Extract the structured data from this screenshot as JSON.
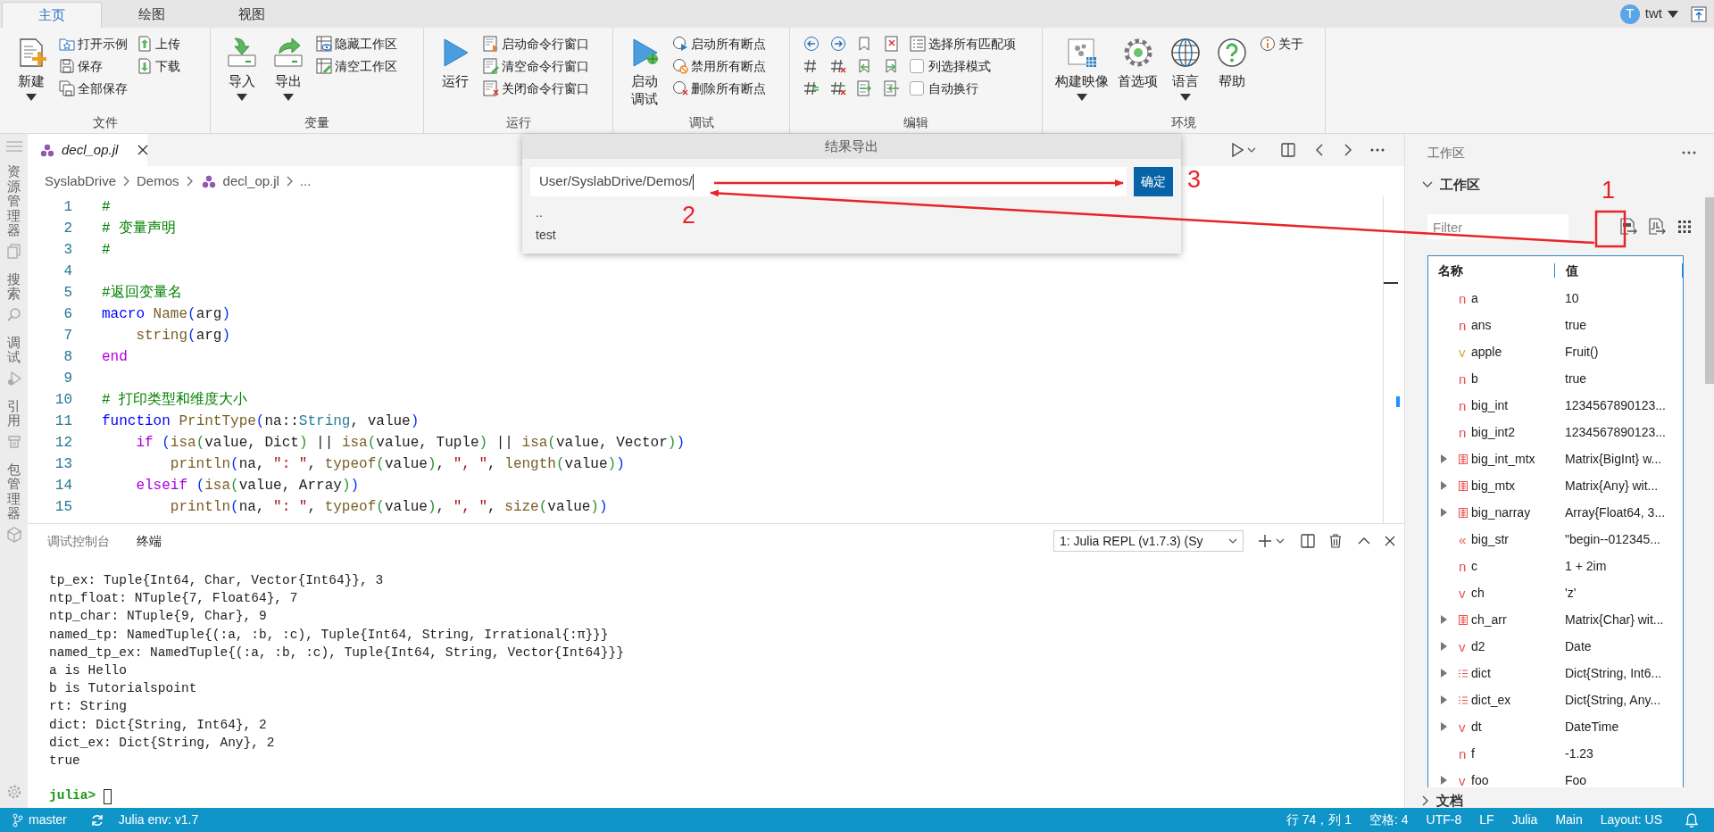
{
  "ribbon": {
    "tabs": [
      {
        "label": "主页",
        "selected": true
      },
      {
        "label": "绘图",
        "selected": false
      },
      {
        "label": "视图",
        "selected": false
      }
    ],
    "user": {
      "initial": "T",
      "name": "twt"
    },
    "groups": [
      {
        "label": "文件",
        "items": [
          {
            "kind": "large",
            "label": "新建",
            "dropdown": true
          },
          {
            "kind": "small",
            "label": "打开示例"
          },
          {
            "kind": "small",
            "label": "保存"
          },
          {
            "kind": "small",
            "label": "全部保存"
          },
          {
            "kind": "small",
            "label": "上传"
          },
          {
            "kind": "small",
            "label": "下载"
          }
        ]
      },
      {
        "label": "变量",
        "items": [
          {
            "kind": "large",
            "label": "导入",
            "dropdown": true
          },
          {
            "kind": "large",
            "label": "导出",
            "dropdown": true
          },
          {
            "kind": "small",
            "label": "隐藏工作区"
          },
          {
            "kind": "small",
            "label": "清空工作区"
          }
        ]
      },
      {
        "label": "运行",
        "items": [
          {
            "kind": "large",
            "label": "运行",
            "dropdown": false
          },
          {
            "kind": "small",
            "label": "启动命令行窗口"
          },
          {
            "kind": "small",
            "label": "清空命令行窗口"
          },
          {
            "kind": "small",
            "label": "关闭命令行窗口"
          }
        ]
      },
      {
        "label": "调试",
        "items": [
          {
            "kind": "large",
            "label": "启动调试",
            "dropdown": false,
            "wrap": true
          },
          {
            "kind": "small",
            "label": "启动所有断点"
          },
          {
            "kind": "small",
            "label": "禁用所有断点"
          },
          {
            "kind": "small",
            "label": "删除所有断点"
          }
        ]
      },
      {
        "label": "编辑",
        "items": [
          {
            "kind": "icon"
          },
          {
            "kind": "icon"
          },
          {
            "kind": "icon"
          },
          {
            "kind": "icon"
          },
          {
            "kind": "icon"
          },
          {
            "kind": "icon"
          },
          {
            "kind": "icon"
          },
          {
            "kind": "icon"
          },
          {
            "kind": "icon"
          },
          {
            "kind": "icon"
          },
          {
            "kind": "icon"
          },
          {
            "kind": "icon"
          },
          {
            "kind": "small",
            "label": "选择所有匹配项"
          },
          {
            "kind": "checkbox",
            "label": "列选择模式",
            "checked": false
          },
          {
            "kind": "checkbox",
            "label": "自动换行",
            "checked": false
          }
        ]
      },
      {
        "label": "环境",
        "items": [
          {
            "kind": "large",
            "label": "构建映像",
            "dropdown": true
          },
          {
            "kind": "large",
            "label": "首选项",
            "dropdown": false
          },
          {
            "kind": "large",
            "label": "语言",
            "dropdown": true
          },
          {
            "kind": "large",
            "label": "帮助",
            "dropdown": false
          },
          {
            "kind": "small",
            "label": "关于"
          }
        ]
      }
    ]
  },
  "activity_bar": [
    {
      "label": "资源管理器"
    },
    {
      "label": "搜索"
    },
    {
      "label": "调试"
    },
    {
      "label": "引用"
    },
    {
      "label": "包管理器"
    }
  ],
  "editor": {
    "tab": {
      "label": "decl_op.jl"
    },
    "breadcrumb": [
      "SyslabDrive",
      "Demos",
      "decl_op.jl",
      "..."
    ],
    "lines": [
      {
        "number": "1",
        "tokens": [
          {
            "kind": "comment",
            "text": "#"
          }
        ]
      },
      {
        "number": "2",
        "tokens": [
          {
            "kind": "comment",
            "text": "# 变量声明"
          }
        ]
      },
      {
        "number": "3",
        "tokens": [
          {
            "kind": "comment",
            "text": "#"
          }
        ]
      },
      {
        "number": "4"
      },
      {
        "number": "5",
        "tokens": [
          {
            "kind": "comment",
            "text": "#返回变量名"
          }
        ]
      },
      {
        "number": "6",
        "tokens": [
          {
            "kind": "keyword",
            "text": "macro "
          },
          {
            "kind": "func",
            "text": "Name"
          },
          {
            "kind": "b1",
            "text": "("
          },
          {
            "kind": "plain",
            "text": "arg"
          },
          {
            "kind": "b1",
            "text": ")"
          }
        ]
      },
      {
        "number": "7",
        "tokens": [
          {
            "kind": "func",
            "text": "    string"
          },
          {
            "kind": "b1",
            "text": "("
          },
          {
            "kind": "plain",
            "text": "arg"
          },
          {
            "kind": "b1",
            "text": ")"
          }
        ]
      },
      {
        "number": "8",
        "tokens": [
          {
            "kind": "control",
            "text": "end"
          }
        ]
      },
      {
        "number": "9"
      },
      {
        "number": "10",
        "tokens": [
          {
            "kind": "comment",
            "text": "# 打印类型和维度大小"
          }
        ]
      },
      {
        "number": "11",
        "tokens": [
          {
            "kind": "keyword",
            "text": "function "
          },
          {
            "kind": "func",
            "text": "PrintType"
          },
          {
            "kind": "b1",
            "text": "("
          },
          {
            "kind": "plain",
            "text": "na::"
          },
          {
            "kind": "type",
            "text": "String"
          },
          {
            "kind": "plain",
            "text": ", value"
          },
          {
            "kind": "b1",
            "text": ")"
          }
        ]
      },
      {
        "number": "12",
        "tokens": [
          {
            "kind": "control",
            "text": "    if "
          },
          {
            "kind": "b1",
            "text": "("
          },
          {
            "kind": "func",
            "text": "isa"
          },
          {
            "kind": "b2",
            "text": "("
          },
          {
            "kind": "plain",
            "text": "value, Dict"
          },
          {
            "kind": "b2",
            "text": ")"
          },
          {
            "kind": "plain",
            "text": " || "
          },
          {
            "kind": "func",
            "text": "isa"
          },
          {
            "kind": "b2",
            "text": "("
          },
          {
            "kind": "plain",
            "text": "value, Tuple"
          },
          {
            "kind": "b2",
            "text": ")"
          },
          {
            "kind": "plain",
            "text": " || "
          },
          {
            "kind": "func",
            "text": "isa"
          },
          {
            "kind": "b2",
            "text": "("
          },
          {
            "kind": "plain",
            "text": "value, Vector"
          },
          {
            "kind": "b2",
            "text": ")"
          },
          {
            "kind": "b1",
            "text": ")"
          }
        ]
      },
      {
        "number": "13",
        "tokens": [
          {
            "kind": "func",
            "text": "        println"
          },
          {
            "kind": "b1",
            "text": "("
          },
          {
            "kind": "plain",
            "text": "na, "
          },
          {
            "kind": "string",
            "text": "\": \""
          },
          {
            "kind": "plain",
            "text": ", "
          },
          {
            "kind": "func",
            "text": "typeof"
          },
          {
            "kind": "b2",
            "text": "("
          },
          {
            "kind": "plain",
            "text": "value"
          },
          {
            "kind": "b2",
            "text": ")"
          },
          {
            "kind": "plain",
            "text": ", "
          },
          {
            "kind": "string",
            "text": "\", \""
          },
          {
            "kind": "plain",
            "text": ", "
          },
          {
            "kind": "func",
            "text": "length"
          },
          {
            "kind": "b2",
            "text": "("
          },
          {
            "kind": "plain",
            "text": "value"
          },
          {
            "kind": "b2",
            "text": ")"
          },
          {
            "kind": "b1",
            "text": ")"
          }
        ]
      },
      {
        "number": "14",
        "tokens": [
          {
            "kind": "control",
            "text": "    elseif "
          },
          {
            "kind": "b1",
            "text": "("
          },
          {
            "kind": "func",
            "text": "isa"
          },
          {
            "kind": "b2",
            "text": "("
          },
          {
            "kind": "plain",
            "text": "value, Array"
          },
          {
            "kind": "b2",
            "text": ")"
          },
          {
            "kind": "b1",
            "text": ")"
          }
        ]
      },
      {
        "number": "15",
        "tokens": [
          {
            "kind": "func",
            "text": "        println"
          },
          {
            "kind": "b1",
            "text": "("
          },
          {
            "kind": "plain",
            "text": "na, "
          },
          {
            "kind": "string",
            "text": "\": \""
          },
          {
            "kind": "plain",
            "text": ", "
          },
          {
            "kind": "func",
            "text": "typeof"
          },
          {
            "kind": "b2",
            "text": "("
          },
          {
            "kind": "plain",
            "text": "value"
          },
          {
            "kind": "b2",
            "text": ")"
          },
          {
            "kind": "plain",
            "text": ", "
          },
          {
            "kind": "string",
            "text": "\", \""
          },
          {
            "kind": "plain",
            "text": ", "
          },
          {
            "kind": "func",
            "text": "size"
          },
          {
            "kind": "b2",
            "text": "("
          },
          {
            "kind": "plain",
            "text": "value"
          },
          {
            "kind": "b2",
            "text": ")"
          },
          {
            "kind": "b1",
            "text": ")"
          }
        ]
      }
    ]
  },
  "export_dialog": {
    "title": "结果导出",
    "path": "User/SyslabDrive/Demos/",
    "confirm": "确定",
    "entries": [
      "..",
      "test"
    ]
  },
  "terminal": {
    "tabs": [
      {
        "label": "调试控制台",
        "selected": false
      },
      {
        "label": "终端",
        "selected": true
      }
    ],
    "session": "1: Julia REPL (v1.7.3) (Sy",
    "lines": [
      "tp_ex: Tuple{Int64, Char, Vector{Int64}}, 3",
      "ntp_float: NTuple{7, Float64}, 7",
      "ntp_char: NTuple{9, Char}, 9",
      "named_tp: NamedTuple{(:a, :b, :c), Tuple{Int64, String, Irrational{:π}}}",
      "named_tp_ex: NamedTuple{(:a, :b, :c), Tuple{Int64, String, Vector{Int64}}}",
      "a is Hello",
      "b is Tutorialspoint",
      "rt: String",
      "dict: Dict{String, Int64}, 2",
      "dict_ex: Dict{String, Any}, 2",
      "true"
    ],
    "prompt": "julia>"
  },
  "workspace_panel": {
    "title": "工作区",
    "section": {
      "title": "工作区",
      "expanded": true
    },
    "filter": {
      "placeholder": "Filter"
    },
    "columns": [
      "名称",
      "值"
    ],
    "rows": [
      {
        "name": "a",
        "value": "10",
        "kind": "letter",
        "glyph": "n",
        "color": "#e8514f",
        "has_children": false
      },
      {
        "name": "ans",
        "value": "true",
        "kind": "letter",
        "glyph": "n",
        "color": "#e8514f",
        "has_children": false
      },
      {
        "name": "apple",
        "value": "Fruit()",
        "kind": "letter",
        "glyph": "v",
        "color": "#d9a441",
        "has_children": false
      },
      {
        "name": "b",
        "value": "true",
        "kind": "letter",
        "glyph": "n",
        "color": "#e8514f",
        "has_children": false
      },
      {
        "name": "big_int",
        "value": "1234567890123...",
        "kind": "letter",
        "glyph": "n",
        "color": "#e8514f",
        "has_children": false
      },
      {
        "name": "big_int2",
        "value": "1234567890123...",
        "kind": "letter",
        "glyph": "n",
        "color": "#e8514f",
        "has_children": false
      },
      {
        "name": "big_int_mtx",
        "value": "Matrix{BigInt} w...",
        "kind": "array",
        "color": "#e8514f",
        "has_children": true
      },
      {
        "name": "big_mtx",
        "value": "Matrix{Any} wit...",
        "kind": "array",
        "color": "#e8514f",
        "has_children": true
      },
      {
        "name": "big_narray",
        "value": "Array{Float64, 3...",
        "kind": "array",
        "color": "#e8514f",
        "has_children": true
      },
      {
        "name": "big_str",
        "value": "\"begin--012345...",
        "kind": "letter",
        "glyph": "«",
        "color": "#e8514f",
        "has_children": false
      },
      {
        "name": "c",
        "value": "1 + 2im",
        "kind": "letter",
        "glyph": "n",
        "color": "#e8514f",
        "has_children": false
      },
      {
        "name": "ch",
        "value": "'z'",
        "kind": "letter",
        "glyph": "v",
        "color": "#e8514f",
        "has_children": false
      },
      {
        "name": "ch_arr",
        "value": "Matrix{Char} wit...",
        "kind": "array",
        "color": "#e8514f",
        "has_children": true
      },
      {
        "name": "d2",
        "value": "Date",
        "kind": "letter",
        "glyph": "v",
        "color": "#e8514f",
        "has_children": true
      },
      {
        "name": "dict",
        "value": "Dict{String, Int6...",
        "kind": "dict",
        "color": "#e8514f",
        "has_children": true
      },
      {
        "name": "dict_ex",
        "value": "Dict{String, Any...",
        "kind": "dict",
        "color": "#e8514f",
        "has_children": true
      },
      {
        "name": "dt",
        "value": "DateTime",
        "kind": "letter",
        "glyph": "v",
        "color": "#e8514f",
        "has_children": true
      },
      {
        "name": "f",
        "value": "-1.23",
        "kind": "letter",
        "glyph": "n",
        "color": "#e8514f",
        "has_children": false
      },
      {
        "name": "foo",
        "value": "Foo",
        "kind": "letter",
        "glyph": "v",
        "color": "#e8514f",
        "has_children": true
      }
    ],
    "collapsed_section": {
      "title": "文档",
      "expanded": false
    }
  },
  "status_bar": {
    "left": [
      {
        "kind": "branch",
        "label": "master"
      },
      {
        "kind": "sync"
      },
      {
        "kind": "plain",
        "label": "Julia env: v1.7"
      }
    ],
    "right": [
      {
        "kind": "plain",
        "label": "行 74，列 1"
      },
      {
        "kind": "plain",
        "label": "空格: 4"
      },
      {
        "kind": "plain",
        "label": "UTF-8"
      },
      {
        "kind": "plain",
        "label": "LF"
      },
      {
        "kind": "plain",
        "label": "Julia"
      },
      {
        "kind": "plain",
        "label": "Main"
      },
      {
        "kind": "plain",
        "label": "Layout: US"
      },
      {
        "kind": "bell"
      }
    ]
  },
  "annotations": [
    {
      "label": "1"
    },
    {
      "label": "2"
    },
    {
      "label": "3"
    }
  ]
}
